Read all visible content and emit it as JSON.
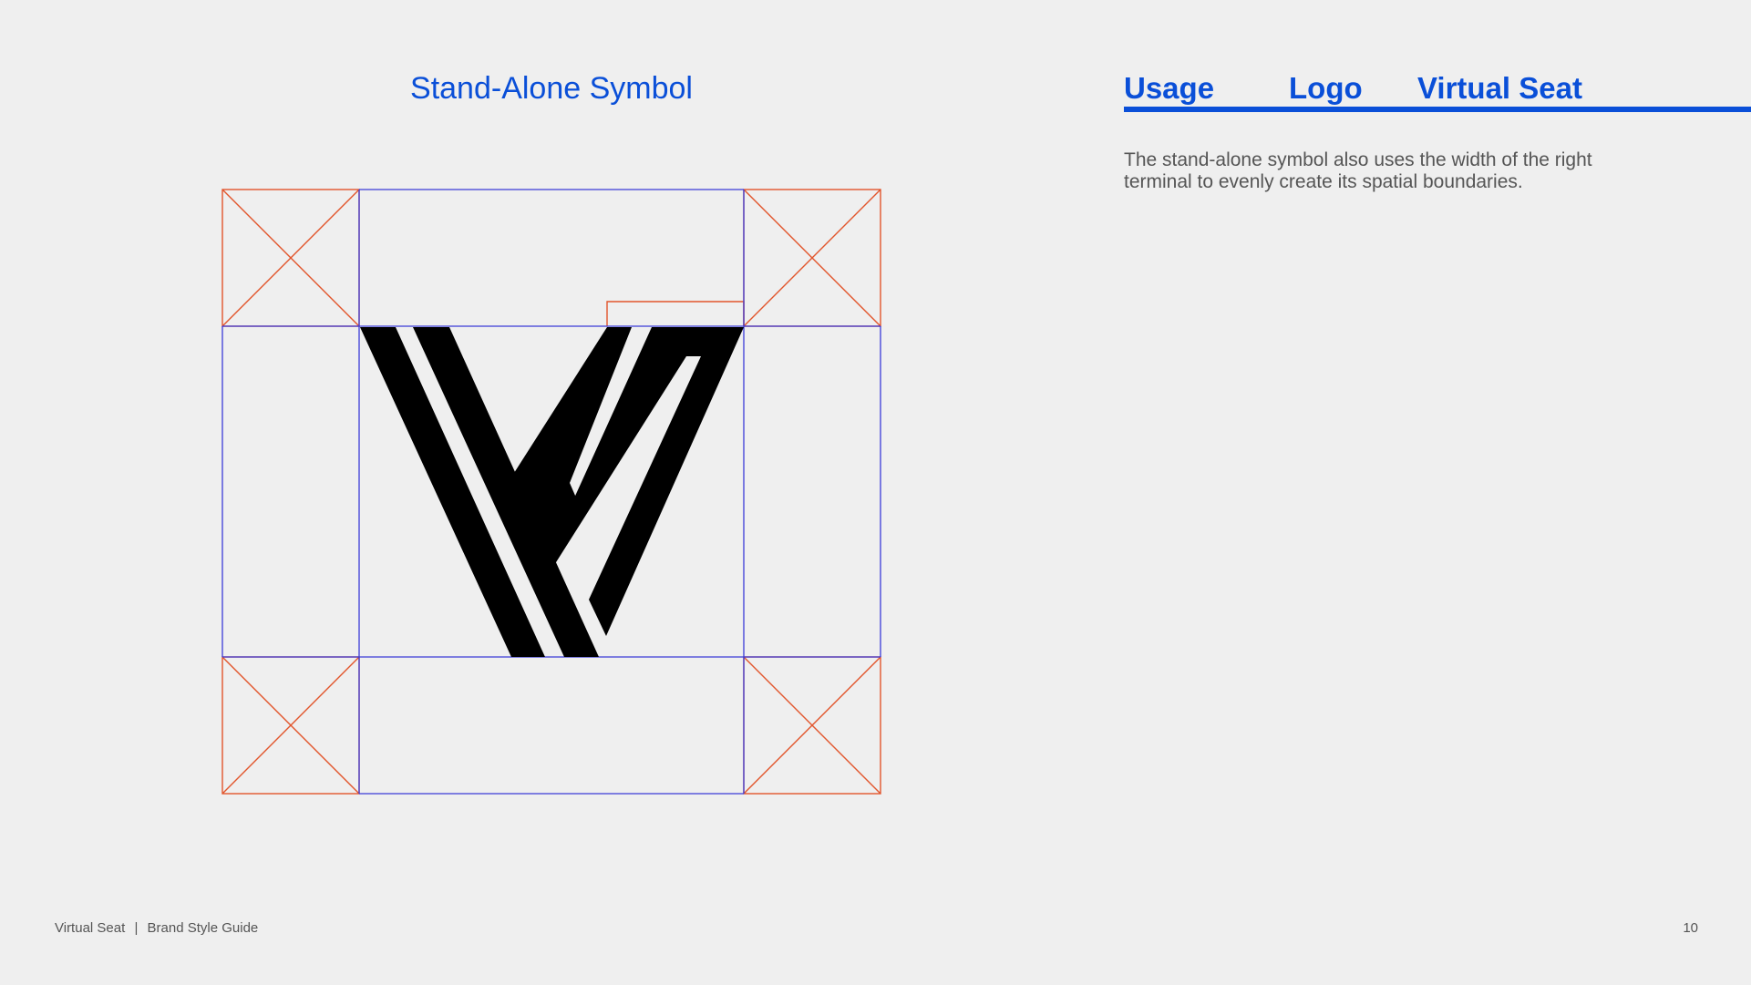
{
  "section": {
    "title": "Stand-Alone Symbol"
  },
  "header": {
    "nav": [
      "Usage",
      "Logo",
      "Virtual Seat"
    ],
    "accent_color": "#0a4fd8"
  },
  "description": "The stand-alone symbol also uses the width of the right terminal to evenly create its spatial boundaries.",
  "diagram": {
    "symbol_color": "#000000",
    "grid_color": "#3a3ad8",
    "clearspace_color": "#e2552c"
  },
  "footer": {
    "brand": "Virtual Seat",
    "separator": "|",
    "doc": "Brand Style Guide",
    "page_number": "10"
  }
}
